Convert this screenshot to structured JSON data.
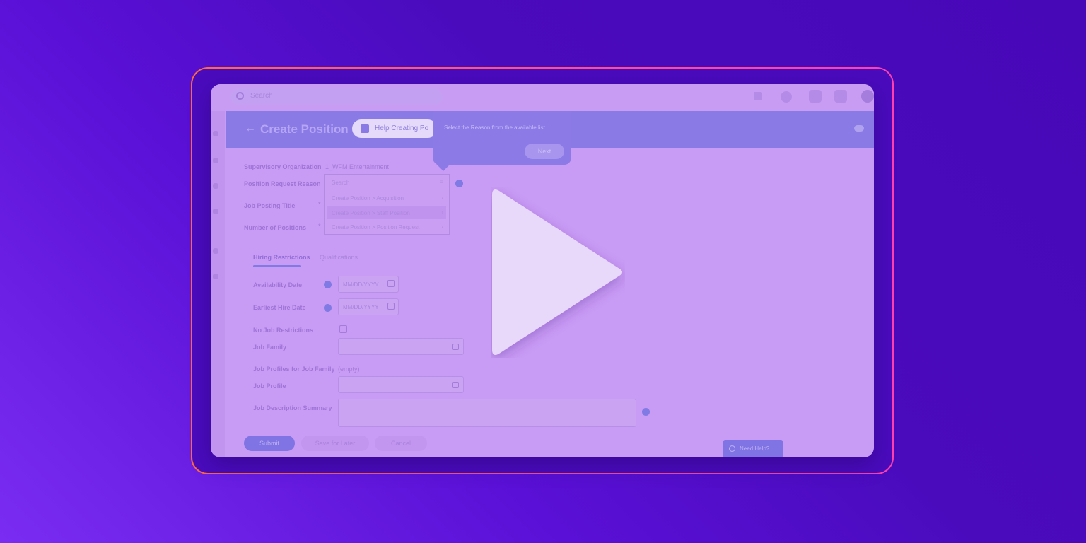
{
  "screen": {
    "search": {
      "placeholder": "Search"
    },
    "header": {
      "back": "←",
      "title": "Create Position",
      "help_button": "Help Creating Po"
    },
    "tooltip": {
      "text": "Select the Reason from the available list",
      "next_button": "Next"
    },
    "form": {
      "supervisory_org_label": "Supervisory Organization",
      "supervisory_org_value": "1_WFM Entertainment",
      "position_reason_label": "Position Request Reason",
      "search_placeholder": "Search",
      "reason_options": [
        {
          "label": "Create Position > Acquisition"
        },
        {
          "label": "Create Position > Staff Position"
        },
        {
          "label": "Create Position > Position Request"
        }
      ],
      "job_posting_label": "Job Posting Title",
      "num_positions_label": "Number of Positions",
      "required_mark": "*"
    },
    "tabs": [
      {
        "label": "Hiring Restrictions"
      },
      {
        "label": "Qualifications"
      }
    ],
    "restrictions": {
      "availability_label": "Availability Date",
      "earliest_hire_label": "Earliest Hire Date",
      "date_placeholder": "MM/DD/YYYY",
      "no_job_restrictions_label": "No Job Restrictions",
      "job_family_label": "Job Family",
      "job_profiles_label": "Job Profiles for Job Family",
      "job_profiles_value": "(empty)",
      "job_profile_label": "Job Profile",
      "job_description_label": "Job Description Summary"
    },
    "actions": {
      "submit": "Submit",
      "save_for_later": "Save for Later",
      "cancel": "Cancel"
    },
    "need_help": "Need Help?"
  },
  "colors": {
    "background_start": "#7a2cf2",
    "background_end": "#4708b8",
    "frame_start": "#ff6a3d",
    "frame_end": "#ff3fb0",
    "overlay": "#c89bf4",
    "play_icon": "#e8d8fa"
  },
  "icons": [
    "search-icon",
    "grid-icon",
    "chat-icon",
    "notifications-icon",
    "inbox-icon",
    "avatar",
    "flag-icon",
    "cloud-icon",
    "calendar-icon",
    "info-icon",
    "play-icon"
  ]
}
